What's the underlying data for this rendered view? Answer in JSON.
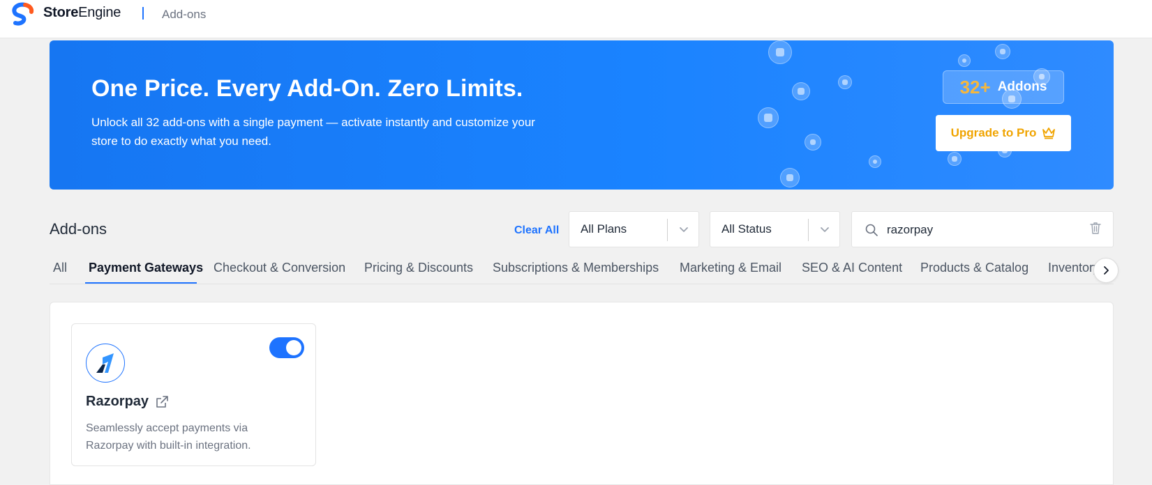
{
  "app": {
    "brand_bold": "Store",
    "brand_rest": "Engine",
    "page": "Add-ons"
  },
  "banner": {
    "title": "One Price. Every Add-On. Zero Limits.",
    "subtitle": "Unlock all 32 add-ons with a single payment — activate instantly and customize your store to do exactly what you need.",
    "badge_count": "32+",
    "badge_label": "Addons",
    "upgrade_label": "Upgrade to Pro",
    "icons": [
      "paypal-icon",
      "stripe-icon",
      "coupon-icon",
      "settings-icon",
      "mail-icon",
      "tag-icon",
      "cart-icon",
      "document-icon",
      "link-icon",
      "calendar-icon"
    ]
  },
  "filters": {
    "section_title": "Add-ons",
    "clear_all": "Clear All",
    "plan_select": "All Plans",
    "status_select": "All Status",
    "search_value": "razorpay"
  },
  "tabs": [
    {
      "label": "All",
      "active": false
    },
    {
      "label": "Payment Gateways",
      "active": true
    },
    {
      "label": "Checkout & Conversion",
      "active": false
    },
    {
      "label": "Pricing & Discounts",
      "active": false
    },
    {
      "label": "Subscriptions & Memberships",
      "active": false
    },
    {
      "label": "Marketing & Email",
      "active": false
    },
    {
      "label": "SEO & AI Content",
      "active": false
    },
    {
      "label": "Products & Catalog",
      "active": false
    },
    {
      "label": "Inventory",
      "active": false
    }
  ],
  "addons": [
    {
      "name": "Razorpay",
      "description": "Seamlessly accept payments via Razorpay with built-in integration.",
      "enabled": true
    }
  ],
  "colors": {
    "accent": "#1e73ff",
    "banner": "#1a83ff",
    "gold": "#f0a400"
  }
}
